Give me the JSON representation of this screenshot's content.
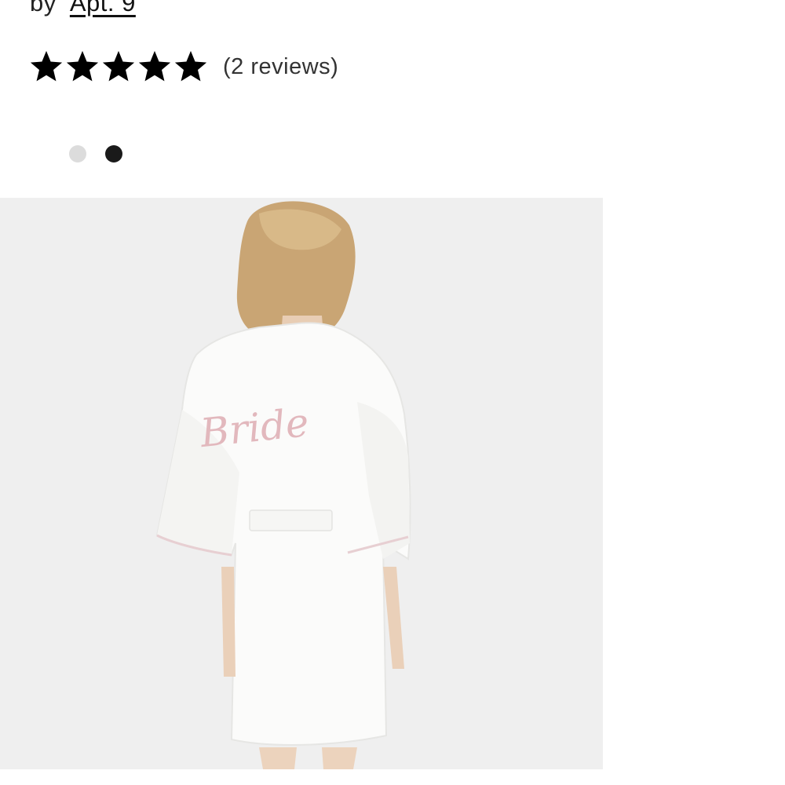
{
  "product": {
    "by_label": "by",
    "brand": "Apt. 9",
    "rating": 5,
    "rating_max": 5,
    "reviews_text": "(2 reviews)"
  },
  "swatches": [
    {
      "name": "white",
      "color": "#dcdcdc",
      "selected": false
    },
    {
      "name": "black",
      "color": "#1a1a1a",
      "selected": true
    }
  ],
  "image": {
    "embroidery_text": "Bride",
    "embroidery_color": "#e2b8bd",
    "background_color": "#efefef"
  }
}
